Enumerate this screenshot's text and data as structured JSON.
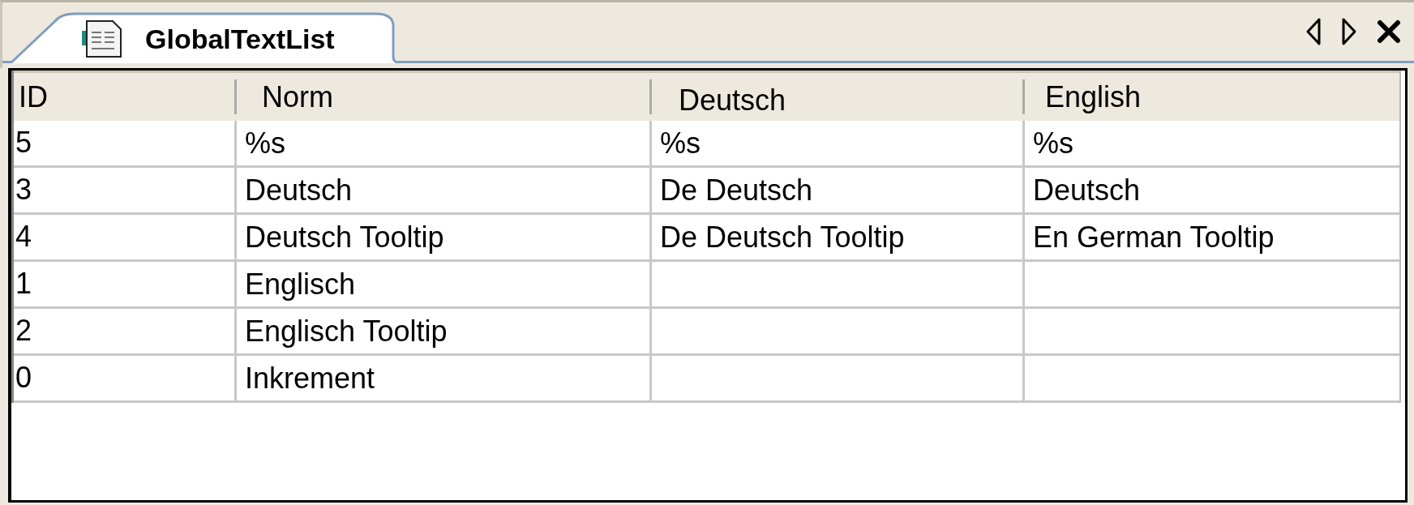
{
  "tab": {
    "title": "GlobalTextList",
    "selected": true
  },
  "table": {
    "columns": [
      "ID",
      "Norm",
      "Deutsch",
      "English"
    ],
    "rows": [
      [
        "5",
        "%s",
        "%s",
        "%s"
      ],
      [
        "3",
        "Deutsch",
        "De Deutsch",
        "Deutsch"
      ],
      [
        "4",
        "Deutsch Tooltip",
        "De Deutsch Tooltip",
        "En German Tooltip"
      ],
      [
        "1",
        "Englisch",
        "",
        ""
      ],
      [
        "2",
        "Englisch Tooltip",
        "",
        ""
      ],
      [
        "0",
        "Inkrement",
        "",
        ""
      ]
    ]
  }
}
